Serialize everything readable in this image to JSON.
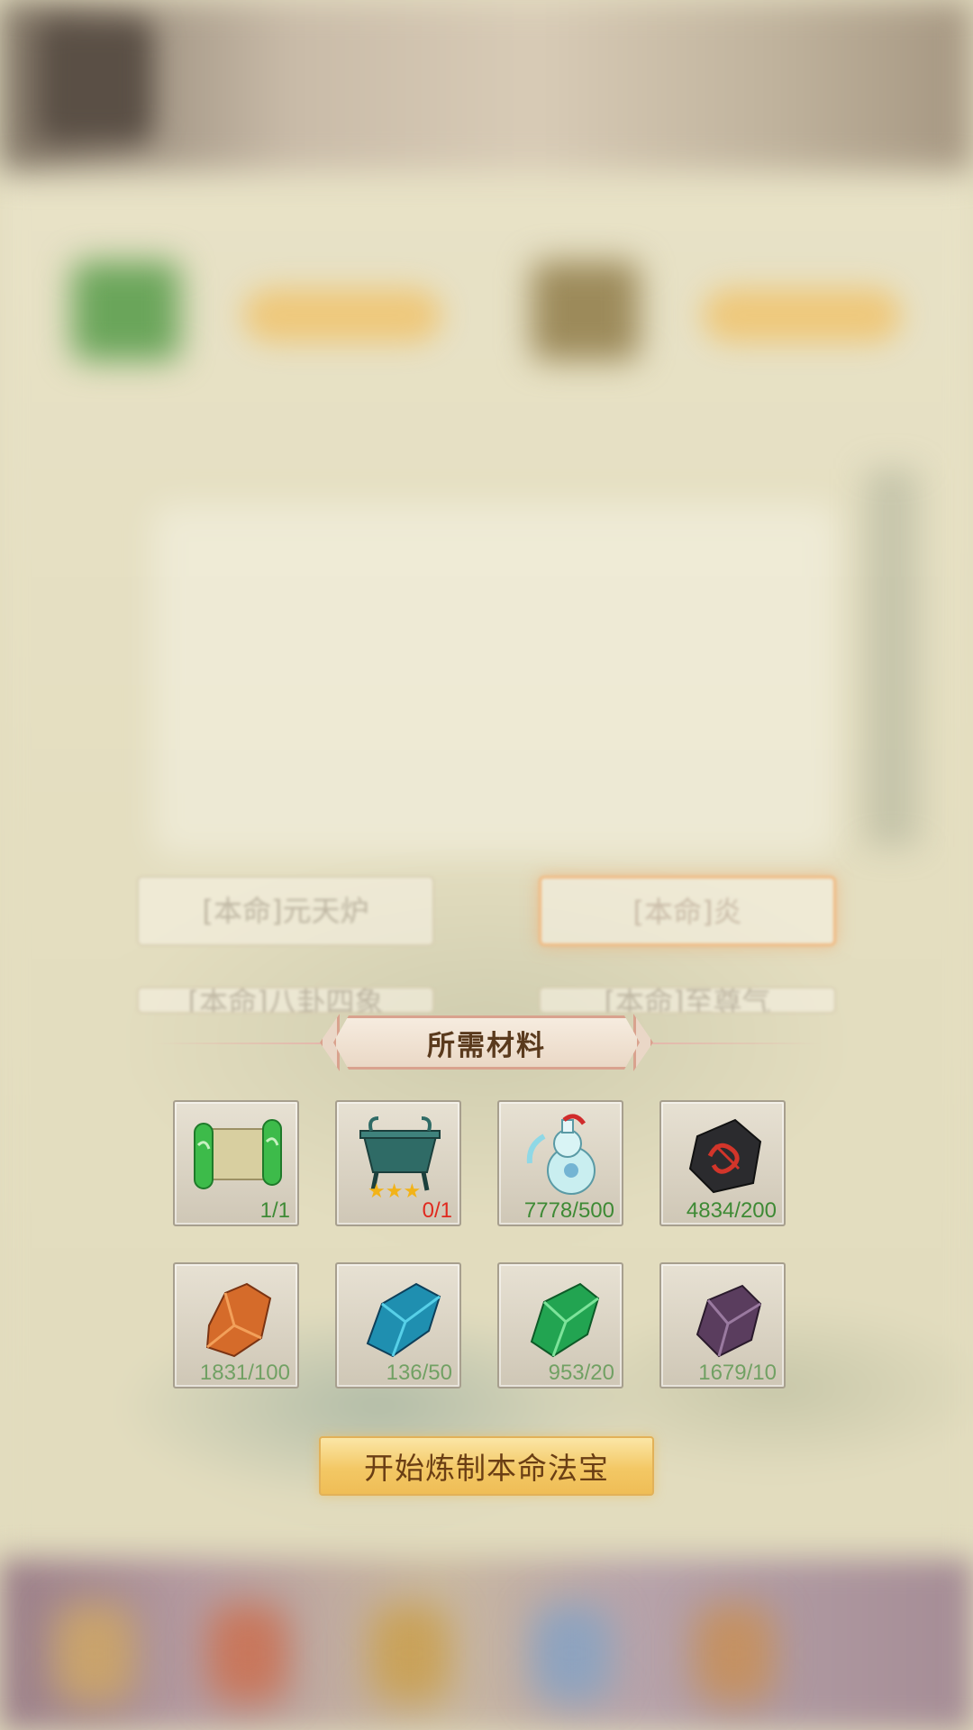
{
  "background": {
    "options": [
      {
        "label": "[本命]元天炉",
        "state": "faded"
      },
      {
        "label": "[本命]炎",
        "state": "selected"
      },
      {
        "label": "[本命]八卦四象",
        "state": "cut"
      },
      {
        "label": "[本命]至尊气",
        "state": "cut"
      }
    ]
  },
  "materials": {
    "title": "所需材料",
    "items": [
      {
        "icon": "scroll-icon",
        "count": "1/1",
        "enough": true
      },
      {
        "icon": "cauldron-icon",
        "count": "0/1",
        "enough": false,
        "stars": 3
      },
      {
        "icon": "potion-gourd-icon",
        "count": "7778/500",
        "enough": true
      },
      {
        "icon": "black-rune-stone-icon",
        "count": "4834/200",
        "enough": true
      },
      {
        "icon": "orange-crystal-icon",
        "count": "1831/100",
        "enough": true
      },
      {
        "icon": "blue-crystal-icon",
        "count": "136/50",
        "enough": true
      },
      {
        "icon": "green-crystal-icon",
        "count": "953/20",
        "enough": true
      },
      {
        "icon": "purple-crystal-icon",
        "count": "1679/10",
        "enough": true
      }
    ]
  },
  "action": {
    "start_label": "开始炼制本命法宝"
  },
  "colors": {
    "count_ok": "#3e8a35",
    "count_short": "#e02a1f",
    "button_gold": "#f3c865",
    "title_text": "#5a3a1d"
  }
}
